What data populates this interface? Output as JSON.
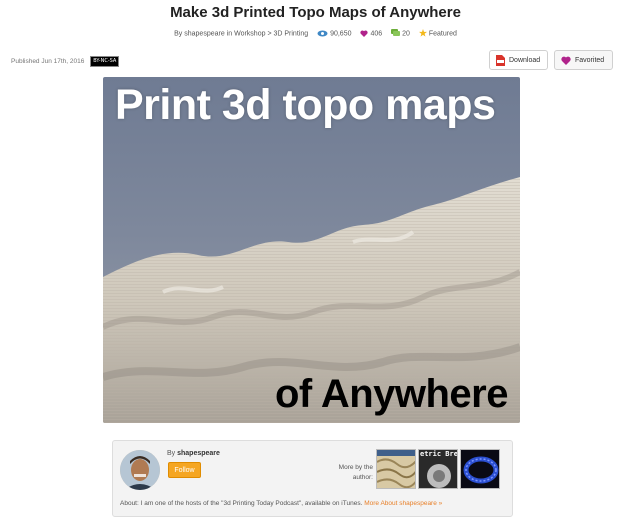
{
  "header": {
    "title": "Make 3d Printed Topo Maps of Anywhere",
    "by_prefix": "By",
    "author": "shapespeare",
    "in_text": "in",
    "category": "Workshop",
    "sep": ">",
    "subcategory": "3D Printing",
    "views": "90,650",
    "favorites": "406",
    "comments": "20",
    "featured": "Featured"
  },
  "published": "Published Jun 17th, 2016",
  "license_badge": "BY-NC-SA",
  "buttons": {
    "download": "Download",
    "favorited": "Favorited"
  },
  "hero": {
    "line1": "Print 3d topo maps",
    "line2": "of Anywhere"
  },
  "author_box": {
    "by_prefix": "By",
    "author": "shapespeare",
    "follow": "Follow",
    "more_by": "More by the author:",
    "about": "About: I am one of the hosts of the \"3d Printing Today Podcast\", available on iTunes.",
    "more_about": "More About shapespeare »",
    "thumb2_text": "etric Brea"
  },
  "colors": {
    "accent_orange": "#f5a623",
    "favorite_pink": "#b0238b",
    "view_blue": "#3f88c5",
    "comment_green": "#6cae3a",
    "star_yellow": "#f3b81a"
  }
}
